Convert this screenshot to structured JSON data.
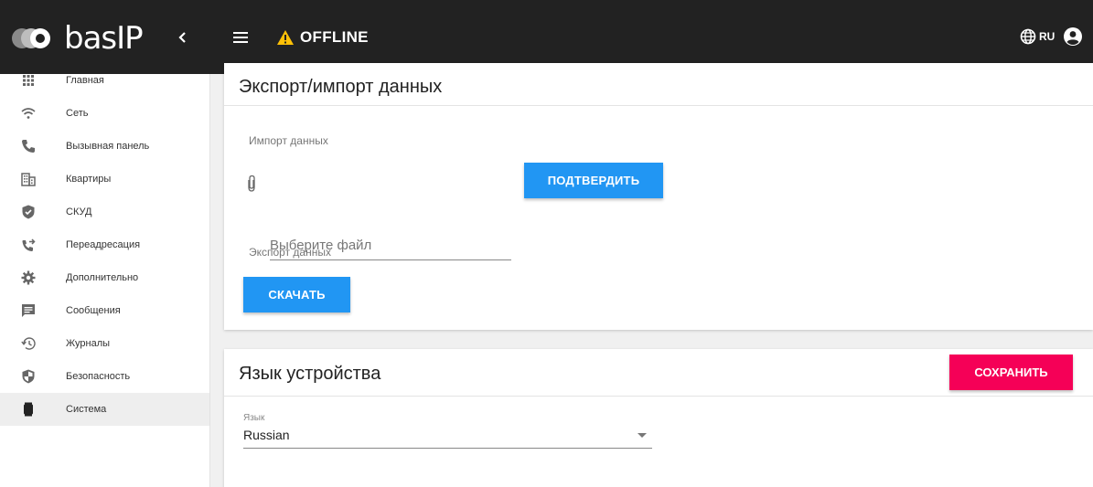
{
  "header": {
    "logo_text": "basIP",
    "collapse_glyph": "‹",
    "status_label": "OFFLINE",
    "language": "RU"
  },
  "sidebar": {
    "items": [
      {
        "label": "Главная",
        "icon": "grid-icon"
      },
      {
        "label": "Сеть",
        "icon": "wifi-icon"
      },
      {
        "label": "Вызывная панель",
        "icon": "phone-icon"
      },
      {
        "label": "Квартиры",
        "icon": "building-icon"
      },
      {
        "label": "СКУД",
        "icon": "shield-check-icon"
      },
      {
        "label": "Переадресация",
        "icon": "call-forward-icon"
      },
      {
        "label": "Дополнительно",
        "icon": "gear-icon"
      },
      {
        "label": "Сообщения",
        "icon": "message-icon"
      },
      {
        "label": "Журналы",
        "icon": "history-icon"
      },
      {
        "label": "Безопасность",
        "icon": "security-icon"
      },
      {
        "label": "Система",
        "icon": "device-icon"
      }
    ],
    "active_index": 10
  },
  "export_import": {
    "title": "Экспорт/импорт данных",
    "import_label": "Импорт данных",
    "file_placeholder": "Выберите файл",
    "confirm_button": "ПОДТВЕРДИТЬ",
    "export_label": "Экспорт данных",
    "download_button": "СКАЧАТЬ"
  },
  "device_language": {
    "title": "Язык устройства",
    "save_button": "СОХРАНИТЬ",
    "field_label": "Язык",
    "selected_value": "Russian"
  },
  "colors": {
    "topbar": "#222222",
    "primary": "#2196f3",
    "accent": "#f50057",
    "warning": "#ffc107"
  }
}
